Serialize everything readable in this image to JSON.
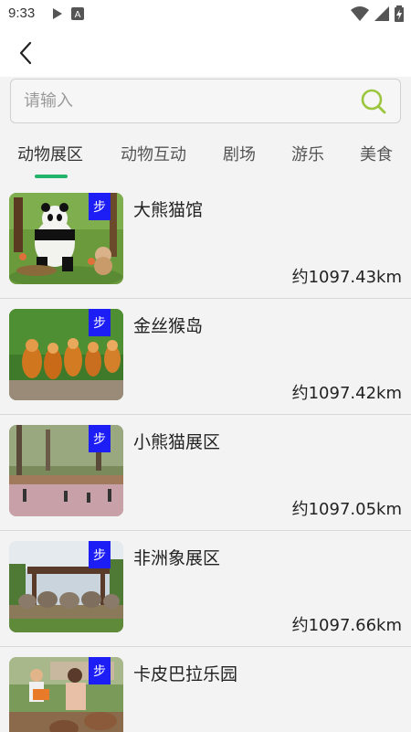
{
  "status_bar": {
    "time": "9:33",
    "icons": [
      "play-icon",
      "a-notification-icon",
      "wifi-icon",
      "signal-icon",
      "battery-charging-icon"
    ]
  },
  "header": {
    "back_icon": "chevron-left-icon"
  },
  "search": {
    "placeholder": "请输入",
    "value": "",
    "icon": "search-icon",
    "icon_color": "#9bc53d"
  },
  "tabs": [
    {
      "label": "动物展区",
      "active": true
    },
    {
      "label": "动物互动",
      "active": false
    },
    {
      "label": "剧场",
      "active": false
    },
    {
      "label": "游乐",
      "active": false
    },
    {
      "label": "美食",
      "active": false
    }
  ],
  "accent_color": "#23b46c",
  "badge_color": "#1d1df5",
  "list": [
    {
      "name": "大熊猫馆",
      "distance": "约1097.43km",
      "badge": "步",
      "thumb": "panda-enclosure-photo"
    },
    {
      "name": "金丝猴岛",
      "distance": "约1097.42km",
      "badge": "步",
      "thumb": "golden-monkeys-photo"
    },
    {
      "name": "小熊猫展区",
      "distance": "约1097.05km",
      "badge": "步",
      "thumb": "red-panda-area-photo"
    },
    {
      "name": "非洲象展区",
      "distance": "约1097.66km",
      "badge": "步",
      "thumb": "african-elephants-photo"
    },
    {
      "name": "卡皮巴拉乐园",
      "distance": "",
      "badge": "步",
      "thumb": "capybara-park-photo"
    }
  ]
}
